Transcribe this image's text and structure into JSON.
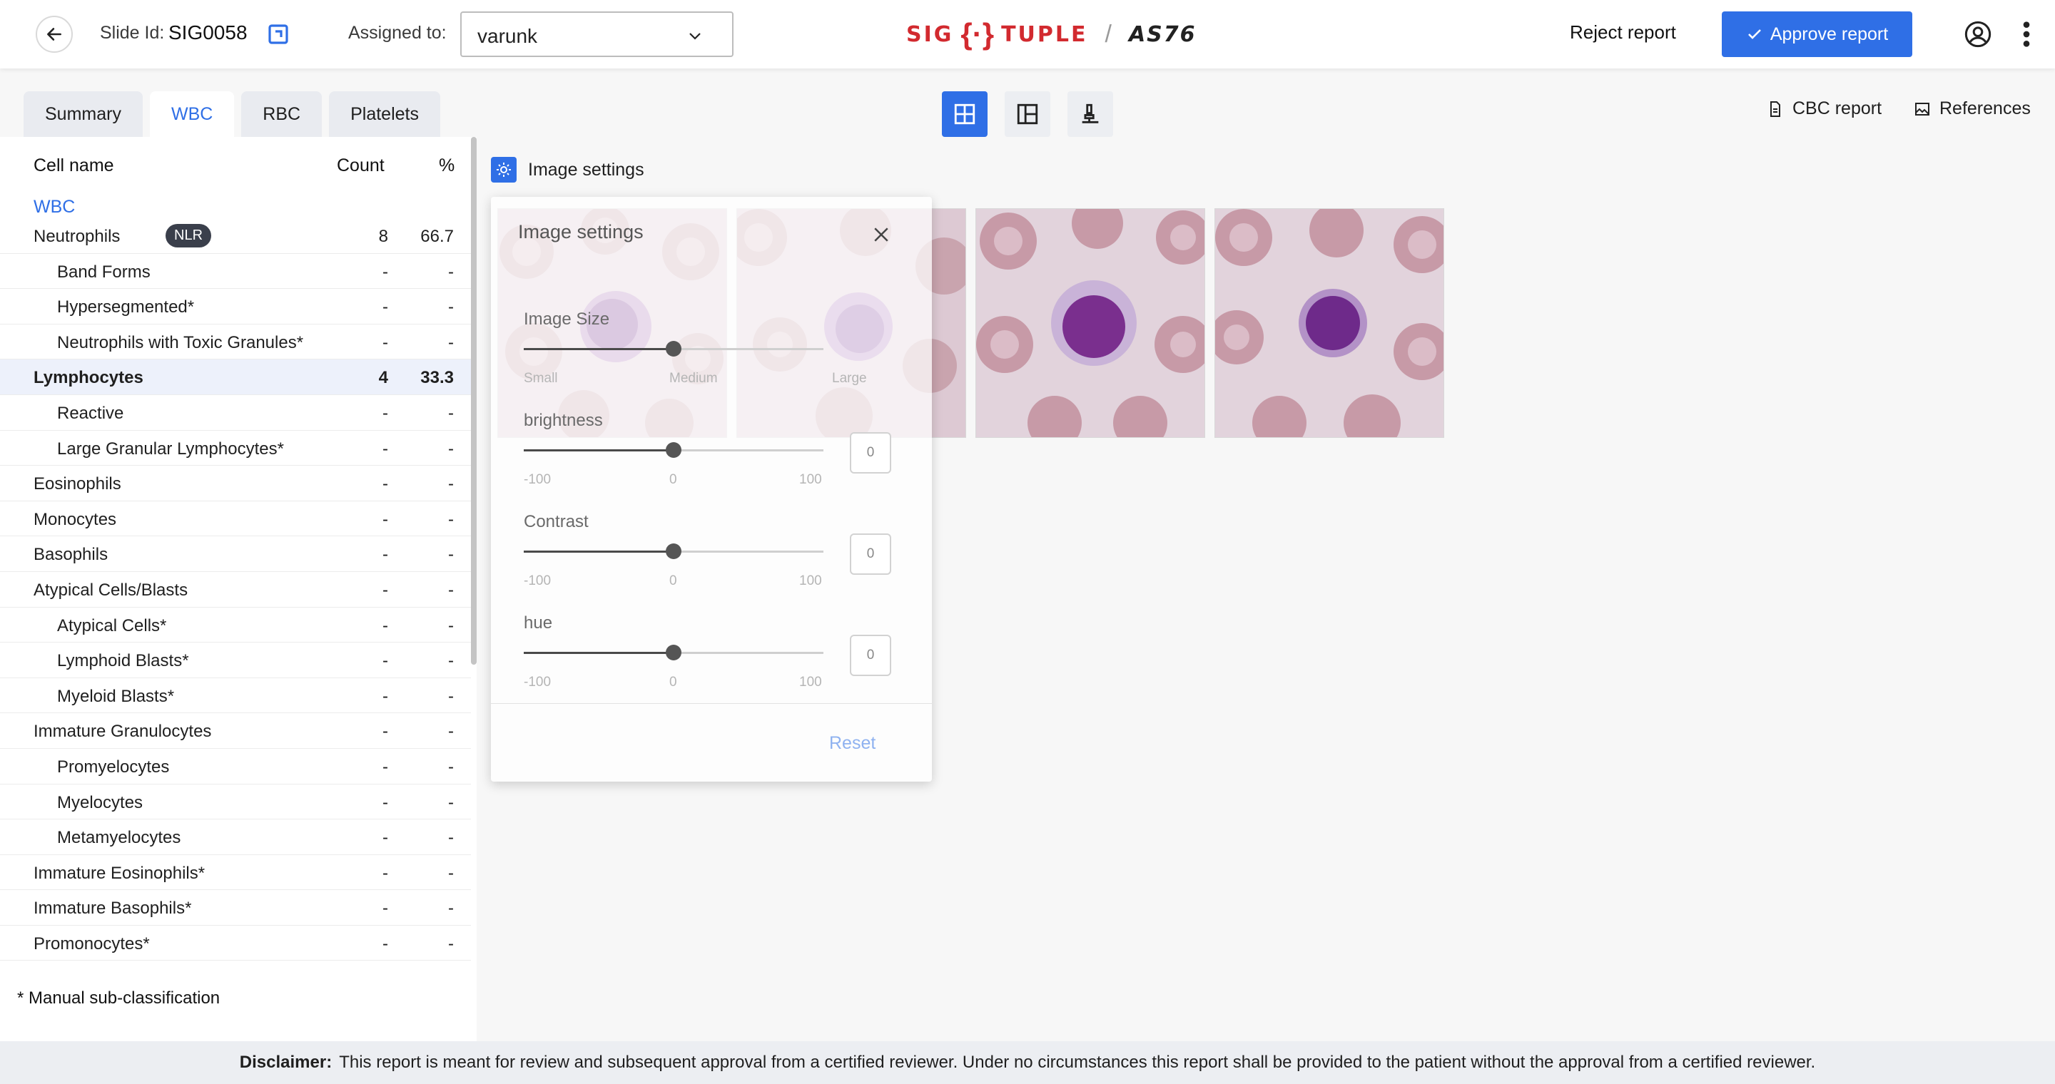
{
  "header": {
    "slide_label": "Slide Id:",
    "slide_id": "SIG0058",
    "assigned_label": "Assigned to:",
    "assigned_value": "varunk",
    "logo_left": "SIG",
    "logo_right": "TUPLE",
    "logo_sep": "/",
    "logo_device": "AS76",
    "reject_label": "Reject report",
    "approve_label": "Approve report",
    "accent_color": "#2f6fe6",
    "brand_color": "#d22a2f"
  },
  "tabs": [
    {
      "label": "Summary",
      "active": false
    },
    {
      "label": "WBC",
      "active": true
    },
    {
      "label": "RBC",
      "active": false
    },
    {
      "label": "Platelets",
      "active": false
    }
  ],
  "toolbar": {
    "cbc_label": "CBC report",
    "references_label": "References"
  },
  "table": {
    "headers": {
      "name": "Cell name",
      "count": "Count",
      "pct": "%"
    },
    "group": "WBC",
    "rows": [
      {
        "name": "Neutrophils",
        "badge": "NLR",
        "count": "8",
        "pct": "66.7",
        "indent": false,
        "bold": false,
        "hl": false
      },
      {
        "name": "Band Forms",
        "count": "-",
        "pct": "-",
        "indent": true
      },
      {
        "name": "Hypersegmented*",
        "count": "-",
        "pct": "-",
        "indent": true
      },
      {
        "name": "Neutrophils with Toxic Granules*",
        "count": "-",
        "pct": "-",
        "indent": true
      },
      {
        "name": "Lymphocytes",
        "count": "4",
        "pct": "33.3",
        "indent": false,
        "bold": true,
        "hl": true
      },
      {
        "name": "Reactive",
        "count": "-",
        "pct": "-",
        "indent": true
      },
      {
        "name": "Large Granular Lymphocytes*",
        "count": "-",
        "pct": "-",
        "indent": true
      },
      {
        "name": "Eosinophils",
        "count": "-",
        "pct": "-",
        "indent": false
      },
      {
        "name": "Monocytes",
        "count": "-",
        "pct": "-",
        "indent": false
      },
      {
        "name": "Basophils",
        "count": "-",
        "pct": "-",
        "indent": false
      },
      {
        "name": "Atypical Cells/Blasts",
        "count": "-",
        "pct": "-",
        "indent": false
      },
      {
        "name": "Atypical Cells*",
        "count": "-",
        "pct": "-",
        "indent": true
      },
      {
        "name": "Lymphoid Blasts*",
        "count": "-",
        "pct": "-",
        "indent": true
      },
      {
        "name": "Myeloid Blasts*",
        "count": "-",
        "pct": "-",
        "indent": true
      },
      {
        "name": "Immature Granulocytes",
        "count": "-",
        "pct": "-",
        "indent": false
      },
      {
        "name": "Promyelocytes",
        "count": "-",
        "pct": "-",
        "indent": true
      },
      {
        "name": "Myelocytes",
        "count": "-",
        "pct": "-",
        "indent": true
      },
      {
        "name": "Metamyelocytes",
        "count": "-",
        "pct": "-",
        "indent": true
      },
      {
        "name": "Immature Eosinophils*",
        "count": "-",
        "pct": "-",
        "indent": false
      },
      {
        "name": "Immature Basophils*",
        "count": "-",
        "pct": "-",
        "indent": false
      },
      {
        "name": "Promonocytes*",
        "count": "-",
        "pct": "-",
        "indent": false
      }
    ],
    "footnote": "* Manual sub-classification"
  },
  "image_settings": {
    "heading": "Image settings",
    "popover_title": "Image settings",
    "size_label": "Image Size",
    "size_ticks": [
      "Small",
      "Medium",
      "Large"
    ],
    "size_value": 0.5,
    "brightness": {
      "label": "brightness",
      "value": "0",
      "min": "-100",
      "mid": "0",
      "max": "100"
    },
    "contrast": {
      "label": "Contrast",
      "value": "0",
      "min": "-100",
      "mid": "0",
      "max": "100"
    },
    "hue": {
      "label": "hue",
      "value": "0",
      "min": "-100",
      "mid": "0",
      "max": "100"
    },
    "reset_label": "Reset"
  },
  "disclaimer": {
    "label": "Disclaimer:",
    "text": "This report is meant for review and subsequent approval from a certified reviewer. Under no circumstances this report shall be provided to the patient without the approval from a certified reviewer."
  }
}
